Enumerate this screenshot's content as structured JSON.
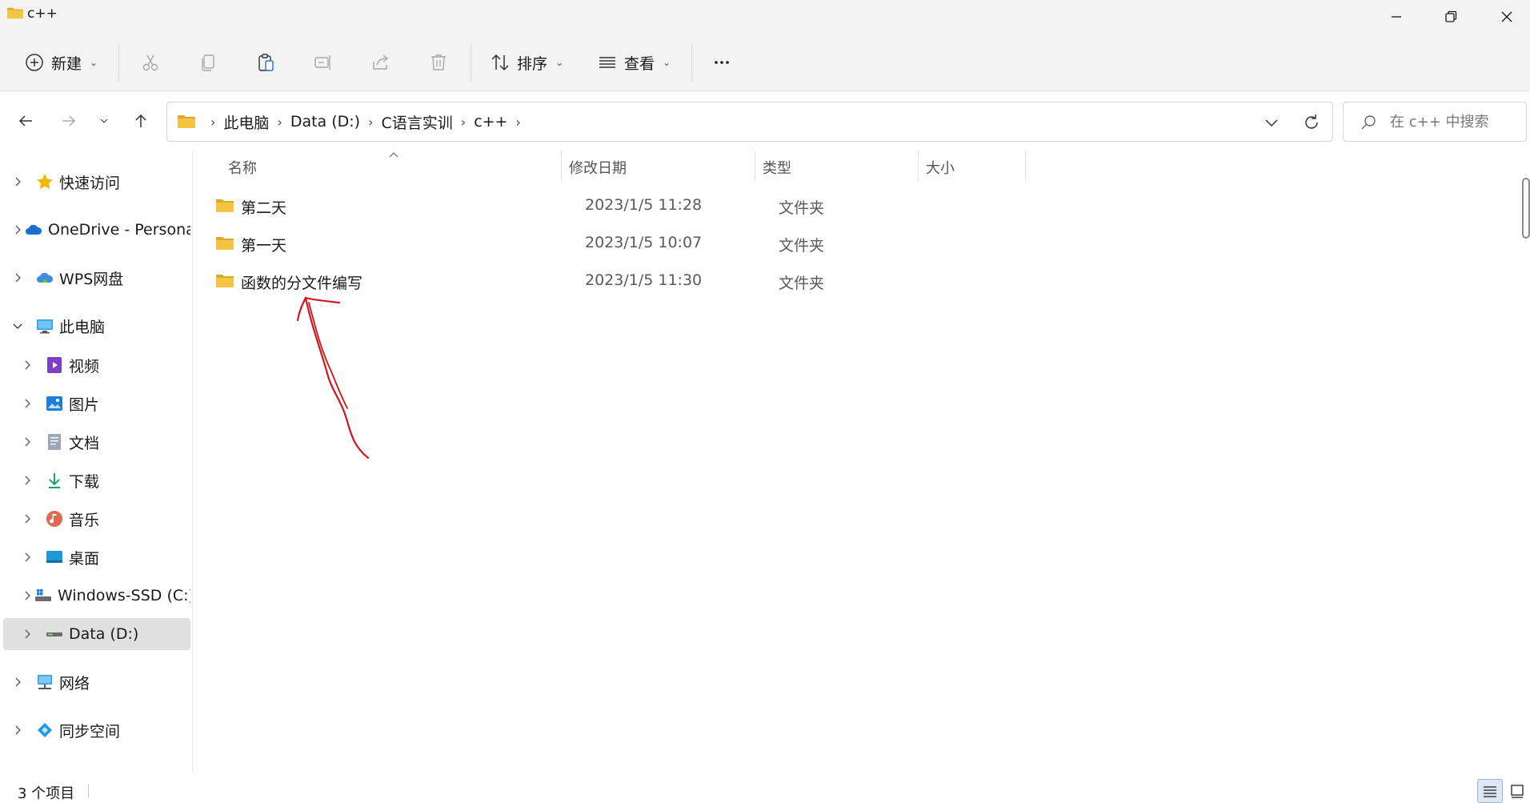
{
  "window": {
    "title": "c++",
    "controls": {
      "minimize": "minimize-icon",
      "maximize": "restore-icon",
      "close": "close-icon"
    }
  },
  "toolbar": {
    "new_label": "新建",
    "sort_label": "排序",
    "view_label": "查看",
    "icons": [
      "plus-circle-icon",
      "cut-icon",
      "copy-icon",
      "paste-icon",
      "rename-icon",
      "share-icon",
      "delete-icon",
      "sort-icon",
      "view-icon",
      "more-icon"
    ]
  },
  "address": {
    "crumbs": [
      "此电脑",
      "Data (D:)",
      "C语言实训",
      "c++"
    ]
  },
  "search": {
    "placeholder": "在 c++ 中搜索"
  },
  "sidebar": {
    "items": [
      {
        "label": "快速访问",
        "icon": "star-icon"
      },
      {
        "label": "OneDrive - Personal",
        "icon": "onedrive-cloud-icon"
      },
      {
        "label": "WPS网盘",
        "icon": "wps-cloud-icon"
      },
      {
        "label": "此电脑",
        "icon": "computer-icon"
      },
      {
        "label": "视频",
        "icon": "video-icon"
      },
      {
        "label": "图片",
        "icon": "pictures-icon"
      },
      {
        "label": "文档",
        "icon": "documents-icon"
      },
      {
        "label": "下载",
        "icon": "download-icon"
      },
      {
        "label": "音乐",
        "icon": "music-icon"
      },
      {
        "label": "桌面",
        "icon": "desktop-icon"
      },
      {
        "label": "Windows-SSD (C:)",
        "icon": "drive-c-icon"
      },
      {
        "label": "Data (D:)",
        "icon": "drive-d-icon"
      },
      {
        "label": "网络",
        "icon": "network-icon"
      },
      {
        "label": "同步空间",
        "icon": "sync-space-icon"
      }
    ]
  },
  "columns": {
    "name": "名称",
    "modified": "修改日期",
    "type": "类型",
    "size": "大小"
  },
  "files": [
    {
      "name": "第二天",
      "modified": "2023/1/5 11:28",
      "type": "文件夹"
    },
    {
      "name": "第一天",
      "modified": "2023/1/5 10:07",
      "type": "文件夹"
    },
    {
      "name": "函数的分文件编写",
      "modified": "2023/1/5 11:30",
      "type": "文件夹"
    }
  ],
  "status": {
    "count": "3 个项目"
  },
  "colors": {
    "folder": "#f4c542",
    "folder_dark": "#e0a82e",
    "annotation_ink": "#d0161c",
    "selected_bg": "#e0e0e0"
  }
}
